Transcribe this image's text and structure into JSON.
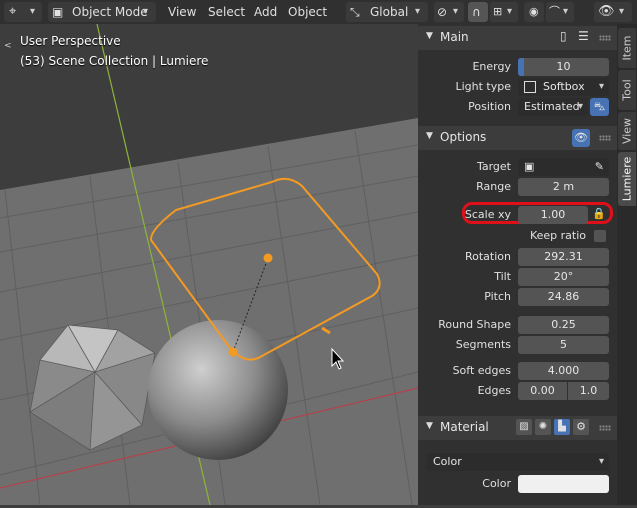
{
  "header": {
    "mode_label": "Object Mode",
    "menus": [
      "View",
      "Select",
      "Add",
      "Object"
    ],
    "orientation_label": "Global"
  },
  "viewport": {
    "perspective_label": "User Perspective",
    "collection_label": "(53) Scene Collection | Lumiere"
  },
  "sidebar_tabs": [
    "Item",
    "Tool",
    "View",
    "Lumiere"
  ],
  "main_panel": {
    "title": "Main",
    "energy_label": "Energy",
    "energy_value": "10",
    "light_type_label": "Light type",
    "light_type_value": "Softbox",
    "position_label": "Position",
    "position_value": "Estimated"
  },
  "options_panel": {
    "title": "Options",
    "target_label": "Target",
    "range_label": "Range",
    "range_value": "2 m",
    "scale_label": "Scale xy",
    "scale_value": "1.00",
    "keep_ratio_label": "Keep ratio",
    "rotation_label": "Rotation",
    "rotation_value": "292.31",
    "tilt_label": "Tilt",
    "tilt_value": "20°",
    "pitch_label": "Pitch",
    "pitch_value": "24.86",
    "round_shape_label": "Round Shape",
    "round_shape_value": "0.25",
    "segments_label": "Segments",
    "segments_value": "5",
    "soft_edges_label": "Soft edges",
    "soft_edges_value": "4.000",
    "edges_label": "Edges",
    "edges_value_1": "0.00",
    "edges_value_2": "1.0"
  },
  "material_panel": {
    "title": "Material",
    "color_mode_value": "Color",
    "color_label": "Color"
  },
  "colors": {
    "highlight_ring": "#e0101a",
    "selection_orange": "#f39a23",
    "accent_blue": "#4772b3",
    "viewport_bg": "#3d3d3d",
    "grid_floor": "#6e6e6e"
  },
  "icons": {
    "editor_type": "view3d-icon",
    "mode": "object-mode-icon",
    "orientation": "transform-orientation-icon",
    "pivot": "pivot-icon",
    "snap": "snap-icon",
    "proportional": "proportional-editing-icon",
    "visibility": "eye-icon",
    "options_visibility": "eye-icon",
    "picker": "eyedropper-icon",
    "lock": "lock-icon"
  }
}
